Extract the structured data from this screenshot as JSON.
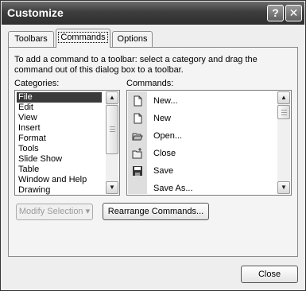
{
  "window": {
    "title": "Customize",
    "help_button": "?",
    "close_button": "✕"
  },
  "tabs": [
    {
      "label": "Toolbars",
      "active": false
    },
    {
      "label": "Commands",
      "active": true
    },
    {
      "label": "Options",
      "active": false
    }
  ],
  "instructions": "To add a command to a toolbar: select a category and drag the command out of this dialog box to a toolbar.",
  "categories": {
    "label": "Categories:",
    "selected": "File",
    "items": [
      "File",
      "Edit",
      "View",
      "Insert",
      "Format",
      "Tools",
      "Slide Show",
      "Table",
      "Window and Help",
      "Drawing"
    ]
  },
  "commands": {
    "label": "Commands:",
    "items": [
      {
        "label": "New...",
        "icon": "new-document-icon"
      },
      {
        "label": "New",
        "icon": "new-document-icon"
      },
      {
        "label": "Open...",
        "icon": "open-folder-icon"
      },
      {
        "label": "Close",
        "icon": "close-document-icon"
      },
      {
        "label": "Save",
        "icon": "save-disk-icon"
      },
      {
        "label": "Save As...",
        "icon": ""
      }
    ]
  },
  "buttons": {
    "modify_selection": "Modify Selection",
    "modify_selection_arrow": "▾",
    "rearrange_commands": "Rearrange Commands...",
    "close": "Close"
  },
  "scroll_arrows": {
    "up": "▲",
    "down": "▼"
  }
}
